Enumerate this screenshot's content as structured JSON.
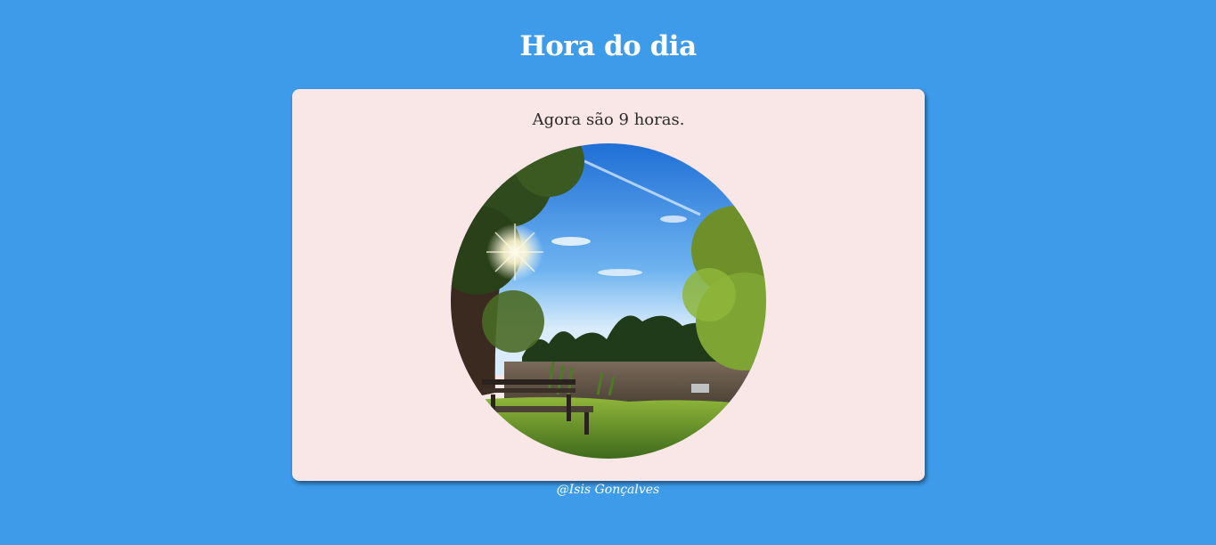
{
  "header": {
    "title": "Hora do dia"
  },
  "card": {
    "message": "Agora são 9 horas.",
    "image": {
      "subject": "morning-lake-park-photo"
    }
  },
  "footer": {
    "credit": "@Isis Gonçalves"
  },
  "colors": {
    "background": "#3d9be9",
    "card": "#f9e6e6",
    "title": "#ffffff",
    "message": "#2b2b2b"
  }
}
